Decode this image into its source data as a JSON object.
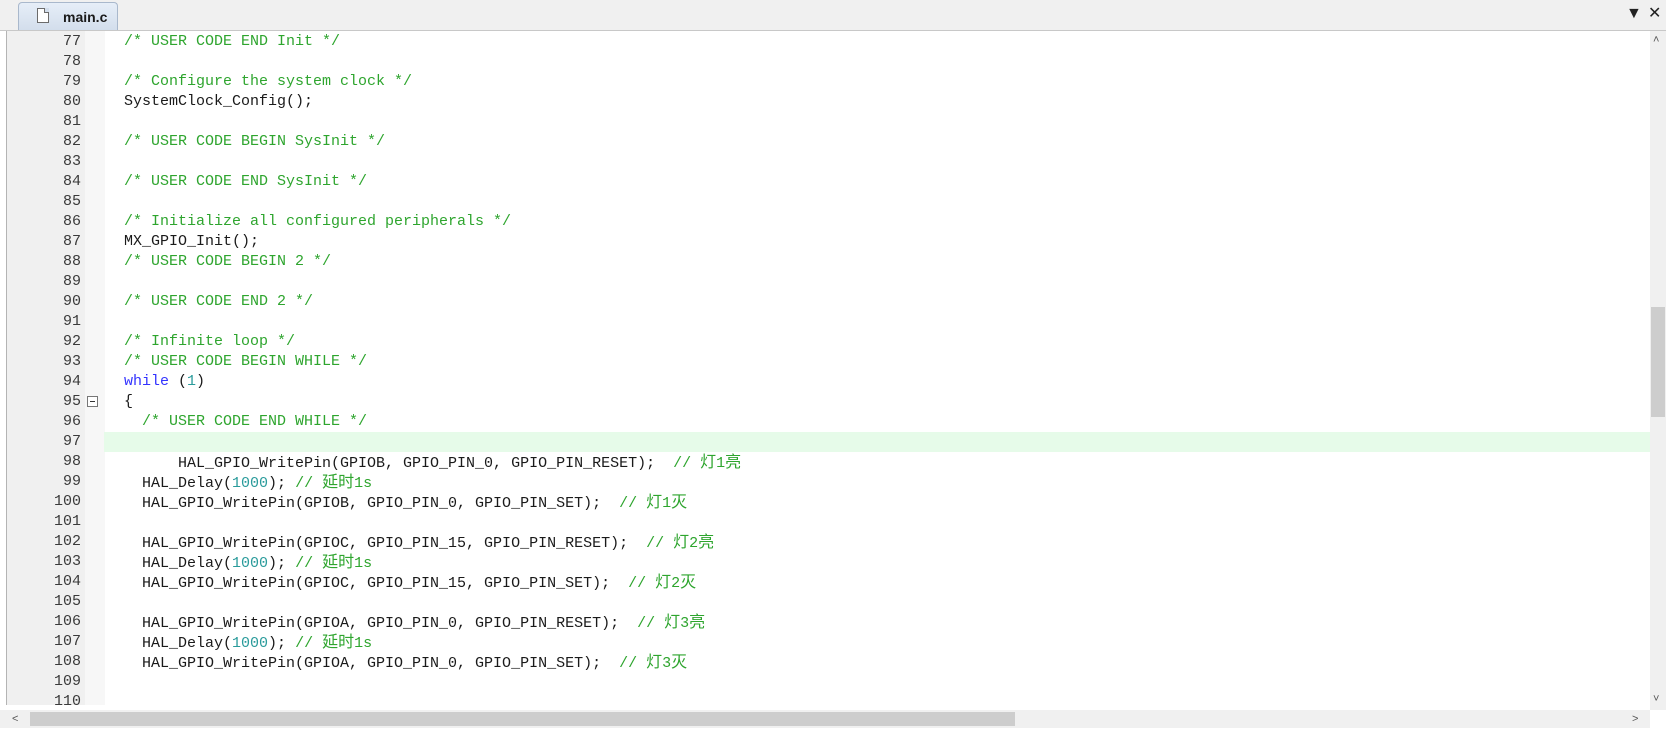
{
  "tab": {
    "filename": "main.c"
  },
  "tabbar": {
    "dropdown_glyph": "▼",
    "close_glyph": "✕"
  },
  "scroll": {
    "up": "˄",
    "down": "˅",
    "left": "<",
    "right": ">"
  },
  "lines": [
    {
      "n": "77",
      "code": "/* USER CODE END Init */"
    },
    {
      "n": "78",
      "code": ""
    },
    {
      "n": "79",
      "code": "/* Configure the system clock */"
    },
    {
      "n": "80",
      "code": "SystemClock_Config();"
    },
    {
      "n": "81",
      "code": ""
    },
    {
      "n": "82",
      "code": "/* USER CODE BEGIN SysInit */"
    },
    {
      "n": "83",
      "code": ""
    },
    {
      "n": "84",
      "code": "/* USER CODE END SysInit */"
    },
    {
      "n": "85",
      "code": ""
    },
    {
      "n": "86",
      "code": "/* Initialize all configured peripherals */"
    },
    {
      "n": "87",
      "code": "MX_GPIO_Init();"
    },
    {
      "n": "88",
      "code": "/* USER CODE BEGIN 2 */"
    },
    {
      "n": "89",
      "code": ""
    },
    {
      "n": "90",
      "code": "/* USER CODE END 2 */"
    },
    {
      "n": "91",
      "code": ""
    },
    {
      "n": "92",
      "code": "/* Infinite loop */"
    },
    {
      "n": "93",
      "code": "/* USER CODE BEGIN WHILE */"
    },
    {
      "n": "94",
      "code": "while (1)"
    },
    {
      "n": "95",
      "code": "{"
    },
    {
      "n": "96",
      "code": "  /* USER CODE END WHILE */"
    },
    {
      "n": "97",
      "code": ""
    },
    {
      "n": "98",
      "code": "      HAL_GPIO_WritePin(GPIOB, GPIO_PIN_0, GPIO_PIN_RESET);  // 灯1亮"
    },
    {
      "n": "99",
      "code": "  HAL_Delay(1000); // 延时1s"
    },
    {
      "n": "100",
      "code": "  HAL_GPIO_WritePin(GPIOB, GPIO_PIN_0, GPIO_PIN_SET);  // 灯1灭"
    },
    {
      "n": "101",
      "code": ""
    },
    {
      "n": "102",
      "code": "  HAL_GPIO_WritePin(GPIOC, GPIO_PIN_15, GPIO_PIN_RESET);  // 灯2亮"
    },
    {
      "n": "103",
      "code": "  HAL_Delay(1000); // 延时1s"
    },
    {
      "n": "104",
      "code": "  HAL_GPIO_WritePin(GPIOC, GPIO_PIN_15, GPIO_PIN_SET);  // 灯2灭"
    },
    {
      "n": "105",
      "code": ""
    },
    {
      "n": "106",
      "code": "  HAL_GPIO_WritePin(GPIOA, GPIO_PIN_0, GPIO_PIN_RESET);  // 灯3亮"
    },
    {
      "n": "107",
      "code": "  HAL_Delay(1000); // 延时1s"
    },
    {
      "n": "108",
      "code": "  HAL_GPIO_WritePin(GPIOA, GPIO_PIN_0, GPIO_PIN_SET);  // 灯3灭"
    },
    {
      "n": "109",
      "code": ""
    },
    {
      "n": "110",
      "code": ""
    }
  ],
  "editor": {
    "current_line": "97",
    "fold_line": "95"
  },
  "colors": {
    "comment": "#2ea52e",
    "keyword": "#3333ff",
    "number": "#2a9b9b",
    "current_line_bg": "#e6fbe9"
  }
}
